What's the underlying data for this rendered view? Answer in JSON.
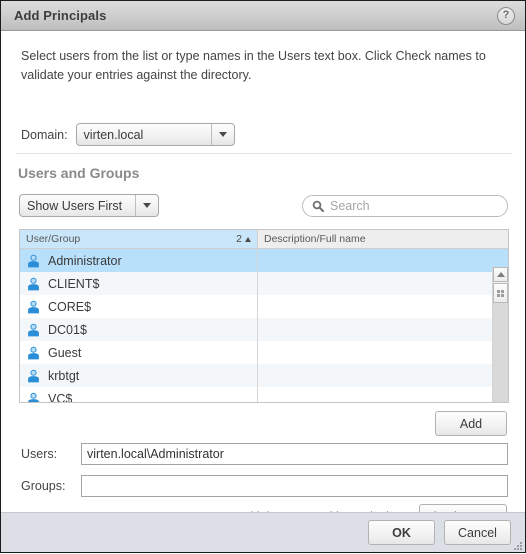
{
  "window": {
    "title": "Add Principals",
    "help_icon": "question-mark-icon"
  },
  "intro_text": "Select users from the list or type names in the Users text box. Click Check names to validate your entries against the directory.",
  "domain": {
    "label": "Domain:",
    "selected": "virten.local"
  },
  "section": {
    "title": "Users and Groups"
  },
  "filter": {
    "selected": "Show Users First"
  },
  "search": {
    "value": "",
    "placeholder": "Search",
    "icon": "magnifier-icon"
  },
  "table": {
    "columns": [
      {
        "label": "User/Group",
        "sort_count": "2",
        "sort_direction": "ascending"
      },
      {
        "label": "Description/Full name"
      }
    ],
    "rows": [
      {
        "name": "Administrator",
        "description": "",
        "icon": "user-icon",
        "selected": true
      },
      {
        "name": "CLIENT$",
        "description": "",
        "icon": "user-icon",
        "selected": false
      },
      {
        "name": "CORE$",
        "description": "",
        "icon": "user-icon",
        "selected": false
      },
      {
        "name": "DC01$",
        "description": "",
        "icon": "user-icon",
        "selected": false
      },
      {
        "name": "Guest",
        "description": "",
        "icon": "user-icon",
        "selected": false
      },
      {
        "name": "krbtgt",
        "description": "",
        "icon": "user-icon",
        "selected": false
      },
      {
        "name": "VC$",
        "description": "",
        "icon": "user-icon",
        "selected": false
      }
    ]
  },
  "buttons": {
    "add": "Add",
    "check_names": "Check names",
    "ok": "OK",
    "cancel": "Cancel"
  },
  "users_field": {
    "label": "Users:",
    "value": "virten.local\\Administrator",
    "placeholder": ""
  },
  "groups_field": {
    "label": "Groups:",
    "value": "",
    "placeholder": ""
  },
  "hint": "Separate multiple names with semicolons",
  "colors": {
    "selection_blue": "#b9e0fb",
    "header_sorted_blue": "#c9e6fa",
    "footer_bg": "#dcdfe6",
    "titlebar_bg": "#d0d0d0",
    "user_icon_blue": "#2a8fd8"
  }
}
